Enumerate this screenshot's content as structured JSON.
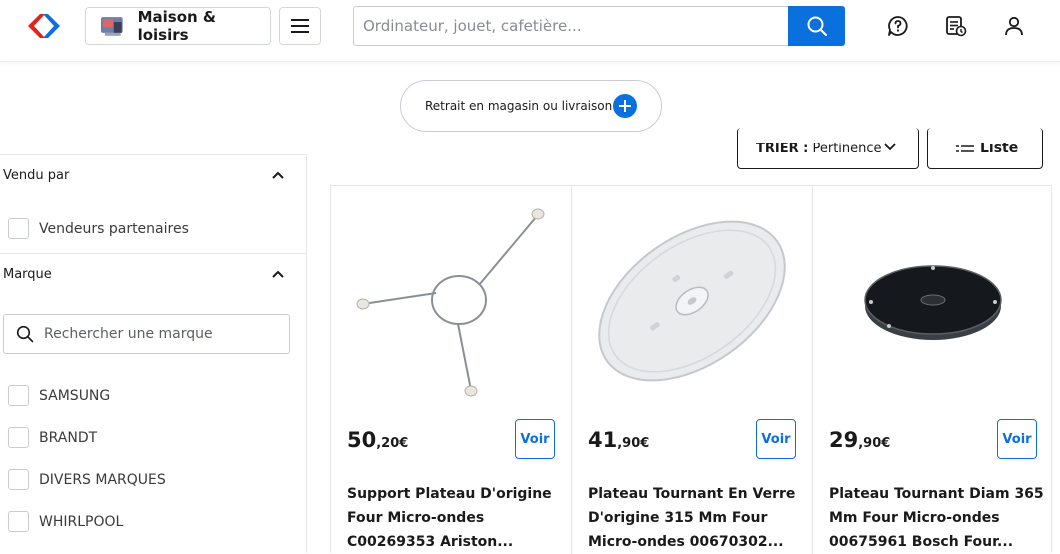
{
  "header": {
    "store_label": "Maison & loisirs",
    "search_placeholder": "Ordinateur, jouet, cafetière...",
    "icons": [
      "carrefour-logo",
      "store-thumbnail",
      "menu-icon",
      "search-icon",
      "help-icon",
      "list-icon",
      "account-icon"
    ],
    "accent_color": "#0a70de"
  },
  "delivery": {
    "label": "Retrait en magasin ou livraison"
  },
  "toolbar": {
    "sort_prefix": "TRIER :",
    "sort_value": "Pertinence",
    "view_label": "Liste"
  },
  "sidebar": {
    "sold_by": {
      "title": "Vendu par",
      "options": [
        "Vendeurs partenaires"
      ]
    },
    "brand": {
      "title": "Marque",
      "search_placeholder": "Rechercher une marque",
      "options": [
        "SAMSUNG",
        "BRANDT",
        "DIVERS MARQUES",
        "WHIRLPOOL"
      ]
    }
  },
  "products": [
    {
      "price_int": "50",
      "price_dec": ",20€",
      "action": "Voir",
      "title": "Support Plateau D'origine Four Micro-ondes C00269353 Ariston..."
    },
    {
      "price_int": "41",
      "price_dec": ",90€",
      "action": "Voir",
      "title": "Plateau Tournant En Verre D'origine 315 Mm Four Micro-ondes 00670302..."
    },
    {
      "price_int": "29",
      "price_dec": ",90€",
      "action": "Voir",
      "title": "Plateau Tournant Diam 365 Mm Four Micro-ondes 00675961 Bosch Four..."
    }
  ]
}
